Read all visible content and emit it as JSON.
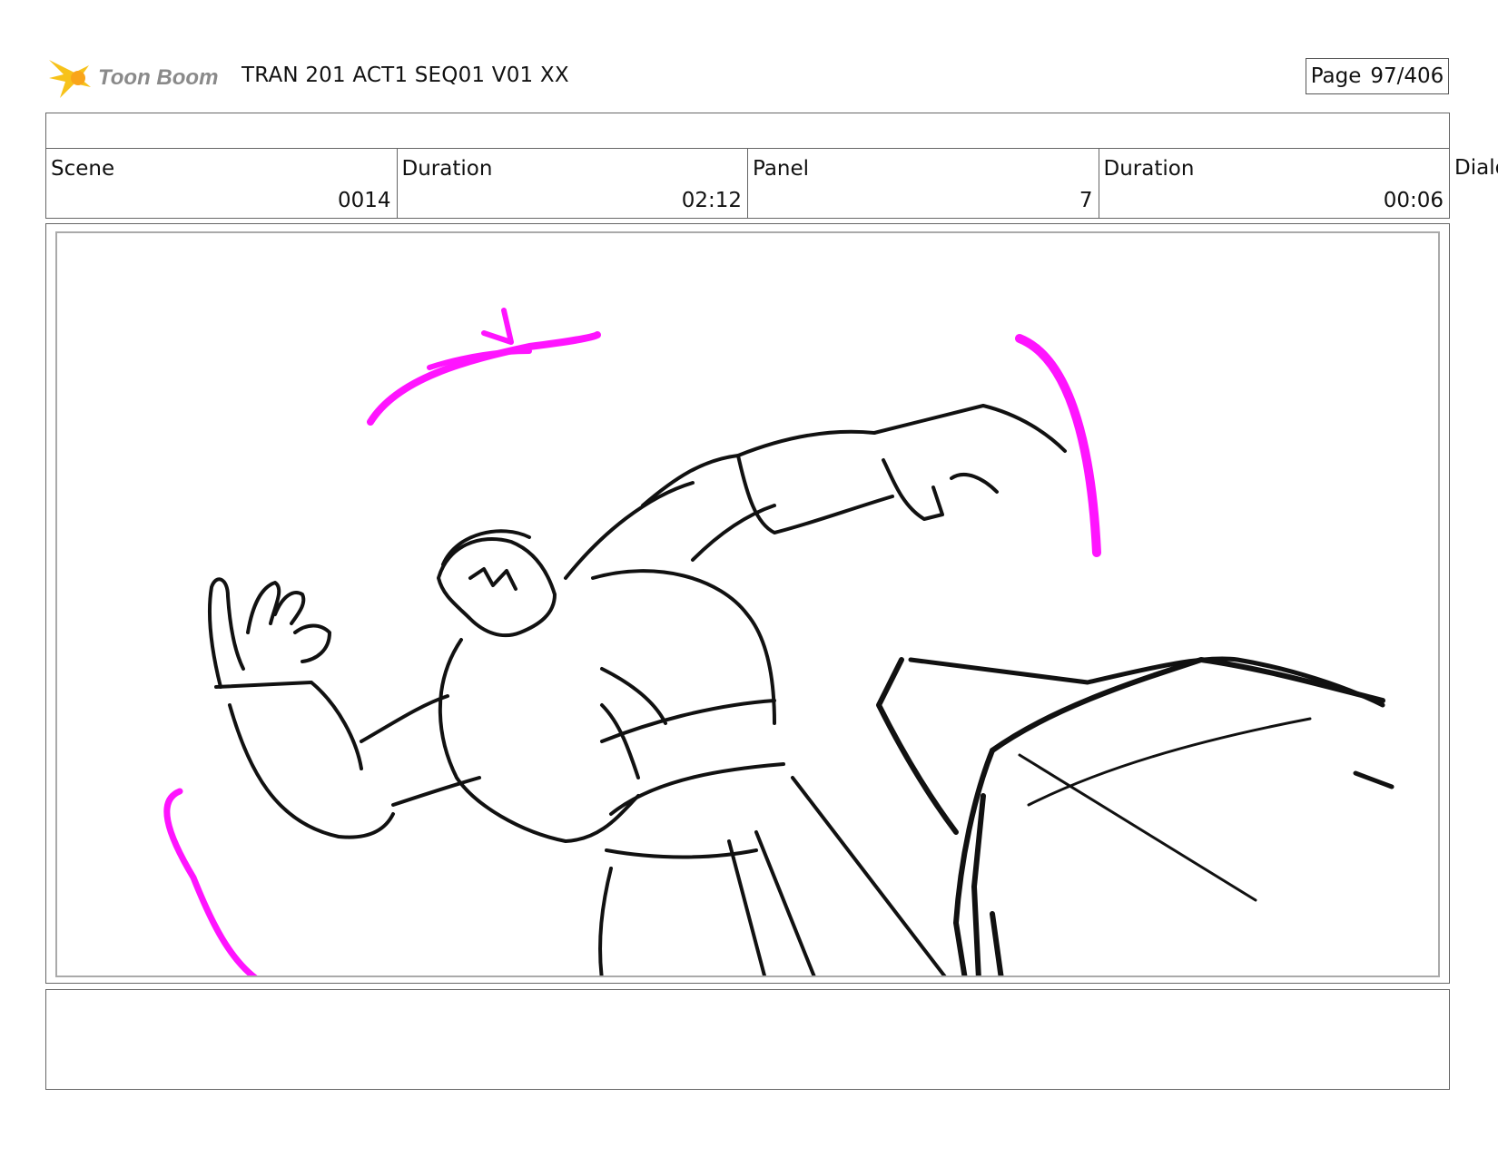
{
  "header": {
    "brand": "Toon Boom",
    "project_title": "TRAN 201 ACT1 SEQ01 V01 XX",
    "page_label": "Page",
    "page_number": "97/406"
  },
  "info": {
    "scene_label": "Scene",
    "scene_value": "0014",
    "scene_duration_label": "Duration",
    "scene_duration_value": "02:12",
    "panel_label": "Panel",
    "panel_value": "7",
    "panel_duration_label": "Duration",
    "panel_duration_value": "00:06",
    "dialog_label": "Dialog"
  },
  "notes": {
    "text": ""
  },
  "colors": {
    "accent_magenta": "#ff14ff",
    "ink": "#111111",
    "logo_yellow": "#f7c21a"
  }
}
